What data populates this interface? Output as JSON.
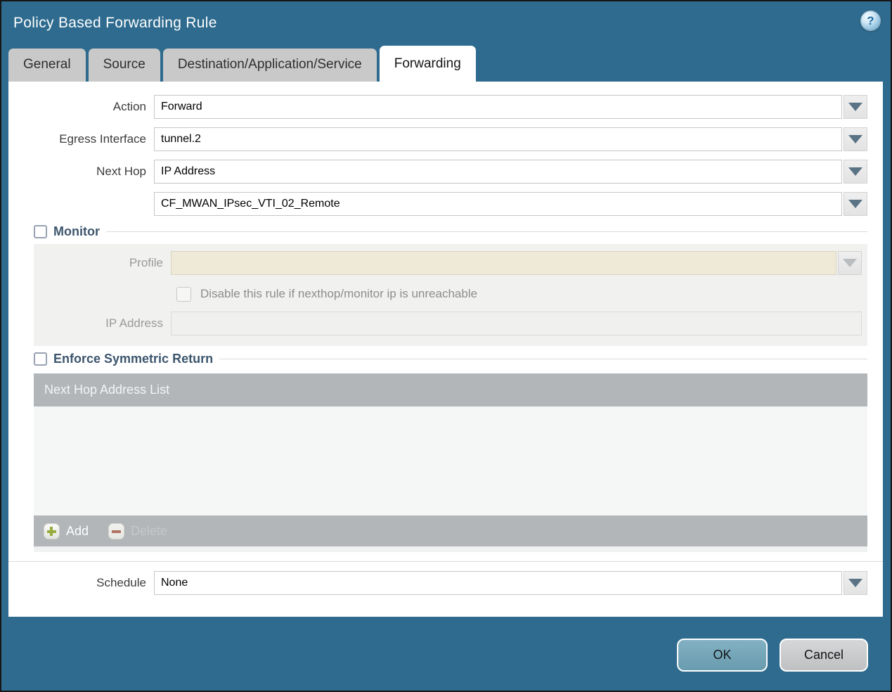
{
  "window": {
    "title": "Policy Based Forwarding Rule"
  },
  "icons": {
    "help_glyph": "?"
  },
  "tabs": [
    {
      "label": "General",
      "active": false
    },
    {
      "label": "Source",
      "active": false
    },
    {
      "label": "Destination/Application/Service",
      "active": false
    },
    {
      "label": "Forwarding",
      "active": true
    }
  ],
  "form": {
    "action": {
      "label": "Action",
      "value": "Forward"
    },
    "egress_interface": {
      "label": "Egress Interface",
      "value": "tunnel.2"
    },
    "next_hop": {
      "label": "Next Hop",
      "value": "IP Address"
    },
    "next_hop_target": {
      "value": "CF_MWAN_IPsec_VTI_02_Remote"
    },
    "schedule": {
      "label": "Schedule",
      "value": "None"
    }
  },
  "monitor": {
    "title": "Monitor",
    "checked": false,
    "profile": {
      "label": "Profile",
      "value": "",
      "disabled": true
    },
    "disable_rule": {
      "label": "Disable this rule if nexthop/monitor ip is unreachable",
      "checked": false,
      "disabled": true
    },
    "ip_address": {
      "label": "IP Address",
      "value": "",
      "disabled": true
    }
  },
  "enforce_symmetric_return": {
    "title": "Enforce Symmetric Return",
    "checked": false,
    "list": {
      "header": "Next Hop Address List",
      "rows": []
    },
    "add_button": "Add",
    "delete_button": "Delete",
    "delete_disabled": true
  },
  "footer": {
    "ok": "OK",
    "cancel": "Cancel"
  },
  "colors": {
    "titlebar_bg": "#2E6B8E",
    "tab_inactive_bg": "#C9C9C9",
    "ok_button": "#74A7BC",
    "cancel_button": "#C8CACB",
    "table_header_gray": "#B2B6B9",
    "disabled_profile_bg": "#EFE9D7",
    "monitor_panel_bg": "#F1F1EF",
    "add_plus_green": "#96AC3C",
    "delete_minus_red": "#B37364"
  }
}
